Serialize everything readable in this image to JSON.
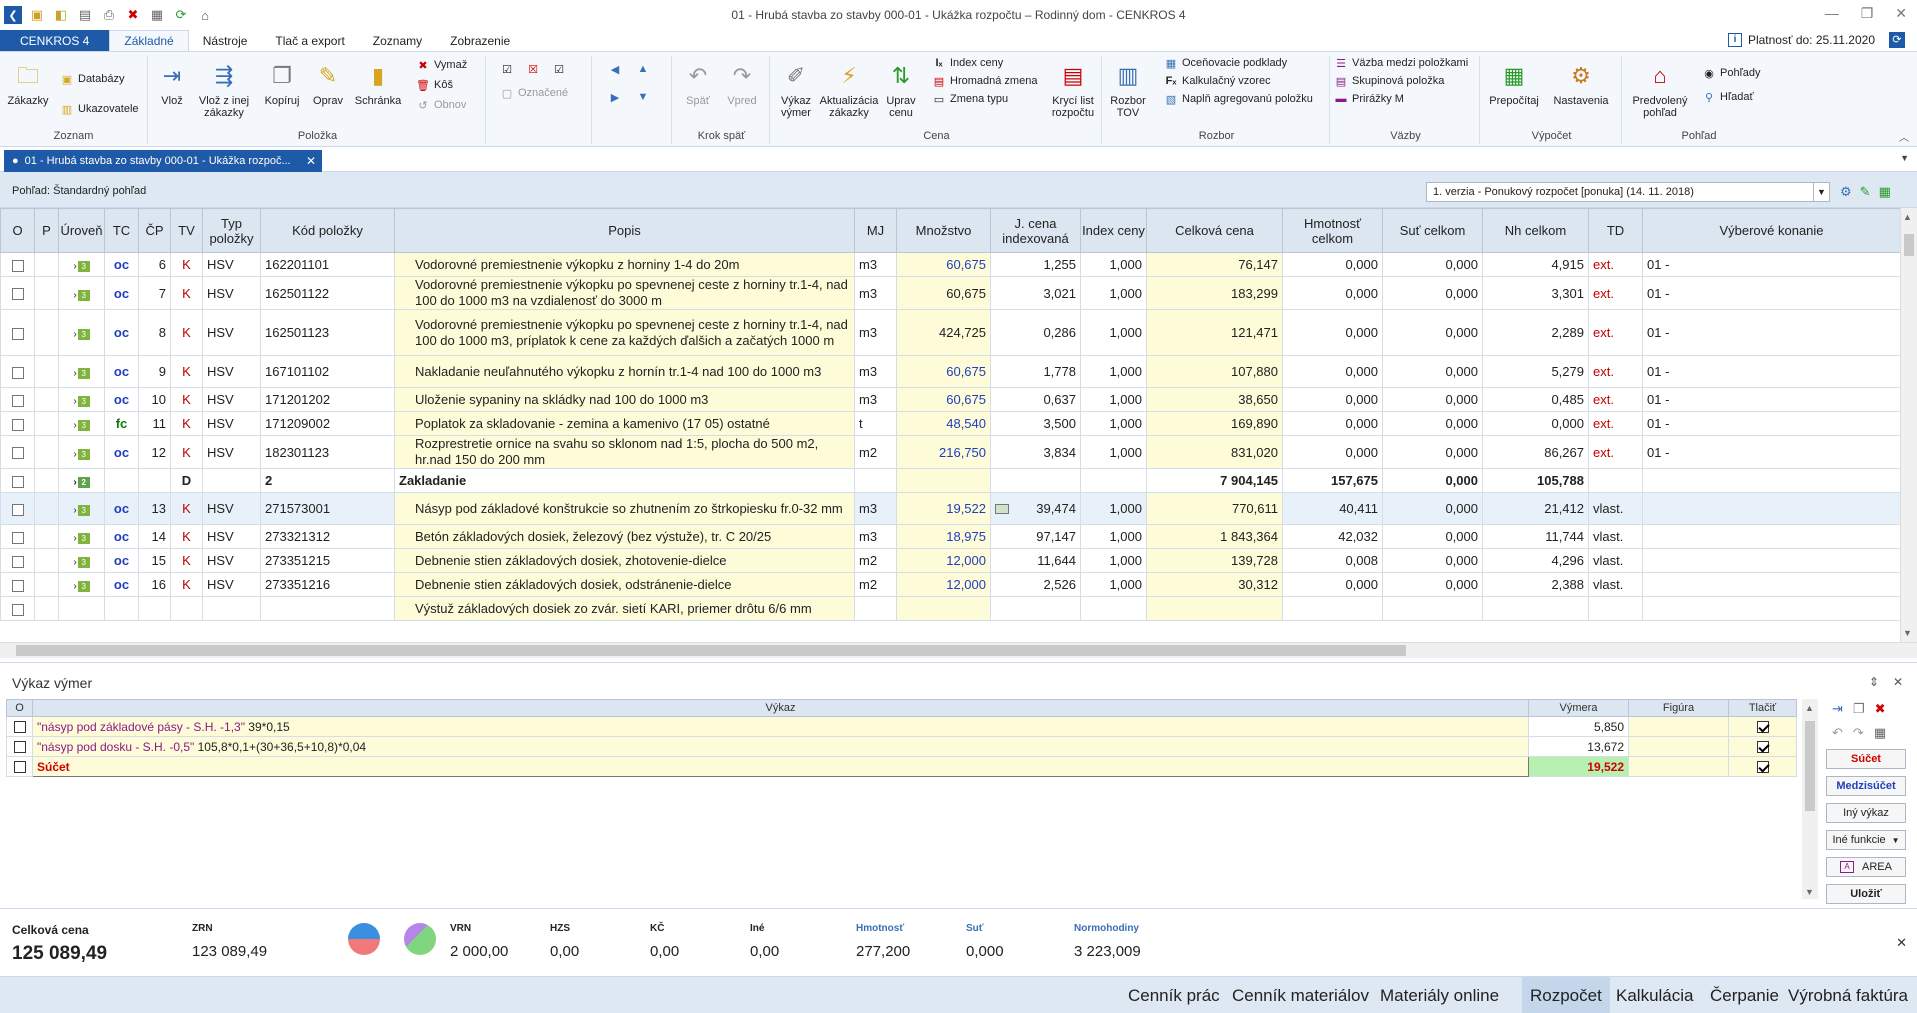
{
  "window": {
    "title": "01 - Hrubá stavba  zo stavby 000-01 - Ukážka rozpočtu – Rodinný dom - CENKROS 4",
    "buttons": [
      "—",
      "❐",
      "✕"
    ]
  },
  "menu": {
    "brand": "CENKROS 4",
    "tabs": [
      "Základné",
      "Nástroje",
      "Tlač a export",
      "Zoznamy",
      "Zobrazenie"
    ],
    "active": "Základné",
    "validity": "Platnosť do: 25.11.2020"
  },
  "ribbon": {
    "zoznam": {
      "label": "Zoznam",
      "zakazky": "Zákazky",
      "databazy": "Databázy",
      "ukazovatele": "Ukazovatele"
    },
    "polozka": {
      "label": "Položka",
      "vloz": "Vlož",
      "vloz_z_inej": "Vlož z inej zákazky",
      "kopiruj": "Kopíruj",
      "oprav": "Oprav",
      "schranka": "Schránka",
      "vymaz": "Vymaž",
      "kos": "Kôš",
      "obnov": "Obnov",
      "oznacene": "Označené"
    },
    "krok": {
      "label": "Krok späť",
      "spat": "Späť",
      "vpred": "Vpred"
    },
    "cena": {
      "label": "Cena",
      "vykaz_vymer": "Výkaz výmer",
      "aktualizacia": "Aktualizácia zákazky",
      "uprav_cenu": "Uprav cenu",
      "index_ceny": "Index ceny",
      "hromadna_zmena": "Hromadná zmena",
      "zmena_typu": "Zmena typu",
      "kryci_list": "Krycí list rozpočtu"
    },
    "rozbor": {
      "label": "Rozbor",
      "rozbor_tov": "Rozbor TOV",
      "ocenovacie": "Oceňovacie podklady",
      "kalkulacny": "Kalkulačný vzorec",
      "napln": "Naplň agregovanú položku"
    },
    "vazby": {
      "label": "Väzby",
      "vazba": "Väzba medzi položkami",
      "skupinova": "Skupinová položka",
      "prirazky": "Prirážky M"
    },
    "vypocet": {
      "label": "Výpočet",
      "prepocitaj": "Prepočítaj",
      "nastavenia": "Nastavenia"
    },
    "pohlad": {
      "label": "Pohľad",
      "predvoleny": "Predvolený pohľad",
      "pohlady": "Pohľady",
      "hladat": "Hľadať"
    }
  },
  "doc_tab": "01 - Hrubá stavba  zo stavby 000-01 - Ukážka rozpoč...",
  "view": {
    "label": "Pohľad: Štandardný pohľad",
    "version": "1. verzia - Ponukový rozpočet [ponuka] (14. 11. 2018)"
  },
  "grid": {
    "headers": [
      "O",
      "P",
      "Úroveň",
      "TC",
      "ČP",
      "TV",
      "Typ položky",
      "Kód položky",
      "Popis",
      "MJ",
      "Množstvo",
      "J. cena indexovaná",
      "Index ceny",
      "Celková cena",
      "Hmotnosť celkom",
      "Suť celkom",
      "Nh celkom",
      "TD",
      "Výberové konanie"
    ],
    "rows": [
      {
        "lvl": "3",
        "tc": "oc",
        "cp": "6",
        "tv": "K",
        "typ": "HSV",
        "kod": "162201101",
        "popis": "Vodorovné premiestnenie výkopku z horniny 1-4 do 20m",
        "mj": "m3",
        "mn": "60,675",
        "mnb": true,
        "jc": "1,255",
        "ic": "1,000",
        "cc": "76,147",
        "hm": "0,000",
        "sut": "0,000",
        "nh": "4,915",
        "td": "ext.",
        "vk": "01 -"
      },
      {
        "lvl": "3",
        "tc": "oc",
        "cp": "7",
        "tv": "K",
        "typ": "HSV",
        "kod": "162501122",
        "popis": "Vodorovné premiestnenie výkopku po spevnenej ceste z horniny tr.1-4, nad 100 do 1000 m3 na vzdialenosť do 3000 m",
        "mj": "m3",
        "mn": "60,675",
        "mnb": false,
        "jc": "3,021",
        "ic": "1,000",
        "cc": "183,299",
        "hm": "0,000",
        "sut": "0,000",
        "nh": "3,301",
        "td": "ext.",
        "vk": "01 -"
      },
      {
        "lvl": "3",
        "tc": "oc",
        "cp": "8",
        "tv": "K",
        "typ": "HSV",
        "kod": "162501123",
        "popis": "Vodorovné premiestnenie výkopku po spevnenej ceste z horniny tr.1-4, nad 100 do 1000 m3, príplatok k cene za každých ďalšich a začatých 1000 m",
        "mj": "m3",
        "mn": "424,725",
        "mnb": false,
        "jc": "0,286",
        "ic": "1,000",
        "cc": "121,471",
        "hm": "0,000",
        "sut": "0,000",
        "nh": "2,289",
        "td": "ext.",
        "vk": "01 -"
      },
      {
        "lvl": "3",
        "tc": "oc",
        "cp": "9",
        "tv": "K",
        "typ": "HSV",
        "kod": "167101102",
        "popis": "Nakladanie neuľahnutého výkopku z hornín tr.1-4 nad 100 do 1000 m3",
        "mj": "m3",
        "mn": "60,675",
        "mnb": true,
        "jc": "1,778",
        "ic": "1,000",
        "cc": "107,880",
        "hm": "0,000",
        "sut": "0,000",
        "nh": "5,279",
        "td": "ext.",
        "vk": "01 -"
      },
      {
        "lvl": "3",
        "tc": "oc",
        "cp": "10",
        "tv": "K",
        "typ": "HSV",
        "kod": "171201202",
        "popis": "Uloženie sypaniny na skládky nad 100 do 1000 m3",
        "mj": "m3",
        "mn": "60,675",
        "mnb": true,
        "jc": "0,637",
        "ic": "1,000",
        "cc": "38,650",
        "hm": "0,000",
        "sut": "0,000",
        "nh": "0,485",
        "td": "ext.",
        "vk": "01 -"
      },
      {
        "lvl": "3",
        "tc": "fc",
        "cp": "11",
        "tv": "K",
        "typ": "HSV",
        "kod": "171209002",
        "popis": "Poplatok za skladovanie - zemina a kamenivo (17 05) ostatné",
        "mj": "t",
        "mn": "48,540",
        "mnb": true,
        "jc": "3,500",
        "ic": "1,000",
        "cc": "169,890",
        "hm": "0,000",
        "sut": "0,000",
        "nh": "0,000",
        "td": "ext.",
        "vk": "01 -"
      },
      {
        "lvl": "3",
        "tc": "oc",
        "cp": "12",
        "tv": "K",
        "typ": "HSV",
        "kod": "182301123",
        "popis": "Rozprestretie ornice na svahu so sklonom nad 1:5, plocha do 500 m2, hr.nad 150 do 200 mm",
        "mj": "m2",
        "mn": "216,750",
        "mnb": true,
        "jc": "3,834",
        "ic": "1,000",
        "cc": "831,020",
        "hm": "0,000",
        "sut": "0,000",
        "nh": "86,267",
        "td": "ext.",
        "vk": "01 -"
      }
    ],
    "sum_row": {
      "lvl": "2",
      "tv": "D",
      "kod": "2",
      "popis": "Zakladanie",
      "cc": "7 904,145",
      "hm": "157,675",
      "sut": "0,000",
      "nh": "105,788"
    },
    "rows2": [
      {
        "lvl": "3",
        "tc": "oc",
        "cp": "13",
        "tv": "K",
        "typ": "HSV",
        "kod": "271573001",
        "popis": "Násyp pod základové  konštrukcie so zhutnením zo štrkopiesku fr.0-32 mm",
        "mj": "m3",
        "mn": "19,522",
        "mnb": true,
        "jc": "39,474",
        "ic": "1,000",
        "cc": "770,611",
        "hm": "40,411",
        "sut": "0,000",
        "nh": "21,412",
        "td": "vlast.",
        "vk": "",
        "sel": true
      },
      {
        "lvl": "3",
        "tc": "oc",
        "cp": "14",
        "tv": "K",
        "typ": "HSV",
        "kod": "273321312",
        "popis": "Betón základových dosiek, železový (bez výstuže), tr. C 20/25",
        "mj": "m3",
        "mn": "18,975",
        "mnb": true,
        "jc": "97,147",
        "ic": "1,000",
        "cc": "1 843,364",
        "hm": "42,032",
        "sut": "0,000",
        "nh": "11,744",
        "td": "vlast.",
        "vk": ""
      },
      {
        "lvl": "3",
        "tc": "oc",
        "cp": "15",
        "tv": "K",
        "typ": "HSV",
        "kod": "273351215",
        "popis": "Debnenie stien základových dosiek, zhotovenie-dielce",
        "mj": "m2",
        "mn": "12,000",
        "mnb": true,
        "jc": "11,644",
        "ic": "1,000",
        "cc": "139,728",
        "hm": "0,008",
        "sut": "0,000",
        "nh": "4,296",
        "td": "vlast.",
        "vk": ""
      },
      {
        "lvl": "3",
        "tc": "oc",
        "cp": "16",
        "tv": "K",
        "typ": "HSV",
        "kod": "273351216",
        "popis": "Debnenie stien základových dosiek, odstránenie-dielce",
        "mj": "m2",
        "mn": "12,000",
        "mnb": true,
        "jc": "2,526",
        "ic": "1,000",
        "cc": "30,312",
        "hm": "0,000",
        "sut": "0,000",
        "nh": "2,388",
        "td": "vlast.",
        "vk": ""
      },
      {
        "lvl": "",
        "tc": "",
        "cp": "",
        "tv": "",
        "typ": "",
        "kod": "",
        "popis": "Výstuž základových dosiek zo zvár. sietí KARI, priemer drôtu 6/6 mm",
        "mj": "",
        "mn": "",
        "mnb": false,
        "jc": "",
        "ic": "",
        "cc": "",
        "hm": "",
        "sut": "",
        "nh": "",
        "td": "",
        "vk": ""
      }
    ]
  },
  "vykaz": {
    "title": "Výkaz výmer",
    "headers": [
      "O",
      "Výkaz",
      "Výmera",
      "Figúra",
      "Tlačiť"
    ],
    "rows": [
      {
        "label": "\"násyp pod základové pásy - S.H. -1,3\"",
        "expr": " 39*0,15",
        "vymera": "5,850"
      },
      {
        "label": "\"násyp pod dosku - S.H. -0,5\"",
        "expr": " 105,8*0,1+(30+36,5+10,8)*0,04",
        "vymera": "13,672"
      }
    ],
    "sum": {
      "label": "Súčet",
      "vymera": "19,522"
    },
    "buttons": [
      "Súčet",
      "Medzisúčet",
      "Iný výkaz",
      "Iné funkcie",
      "AREA",
      "Uložiť"
    ]
  },
  "summary": {
    "celkova_label": "Celková cena",
    "celkova": "125 089,49",
    "zrn_label": "ZRN",
    "zrn": "123 089,49",
    "vrn_label": "VRN",
    "vrn": "2 000,00",
    "hzs_label": "HZS",
    "hzs": "0,00",
    "kc_label": "KČ",
    "kc": "0,00",
    "ine_label": "Iné",
    "ine": "0,00",
    "hmotnost_label": "Hmotnosť",
    "hmotnost": "277,200",
    "sut_label": "Suť",
    "sut": "0,000",
    "normohodiny_label": "Normohodiny",
    "normohodiny": "3 223,009"
  },
  "bottom_tabs": [
    "Cenník prác",
    "Cenník materiálov",
    "Materiály online",
    "Rozpočet",
    "Kalkulácia",
    "Čerpanie",
    "Výrobná faktúra"
  ],
  "bottom_active": "Rozpočet"
}
